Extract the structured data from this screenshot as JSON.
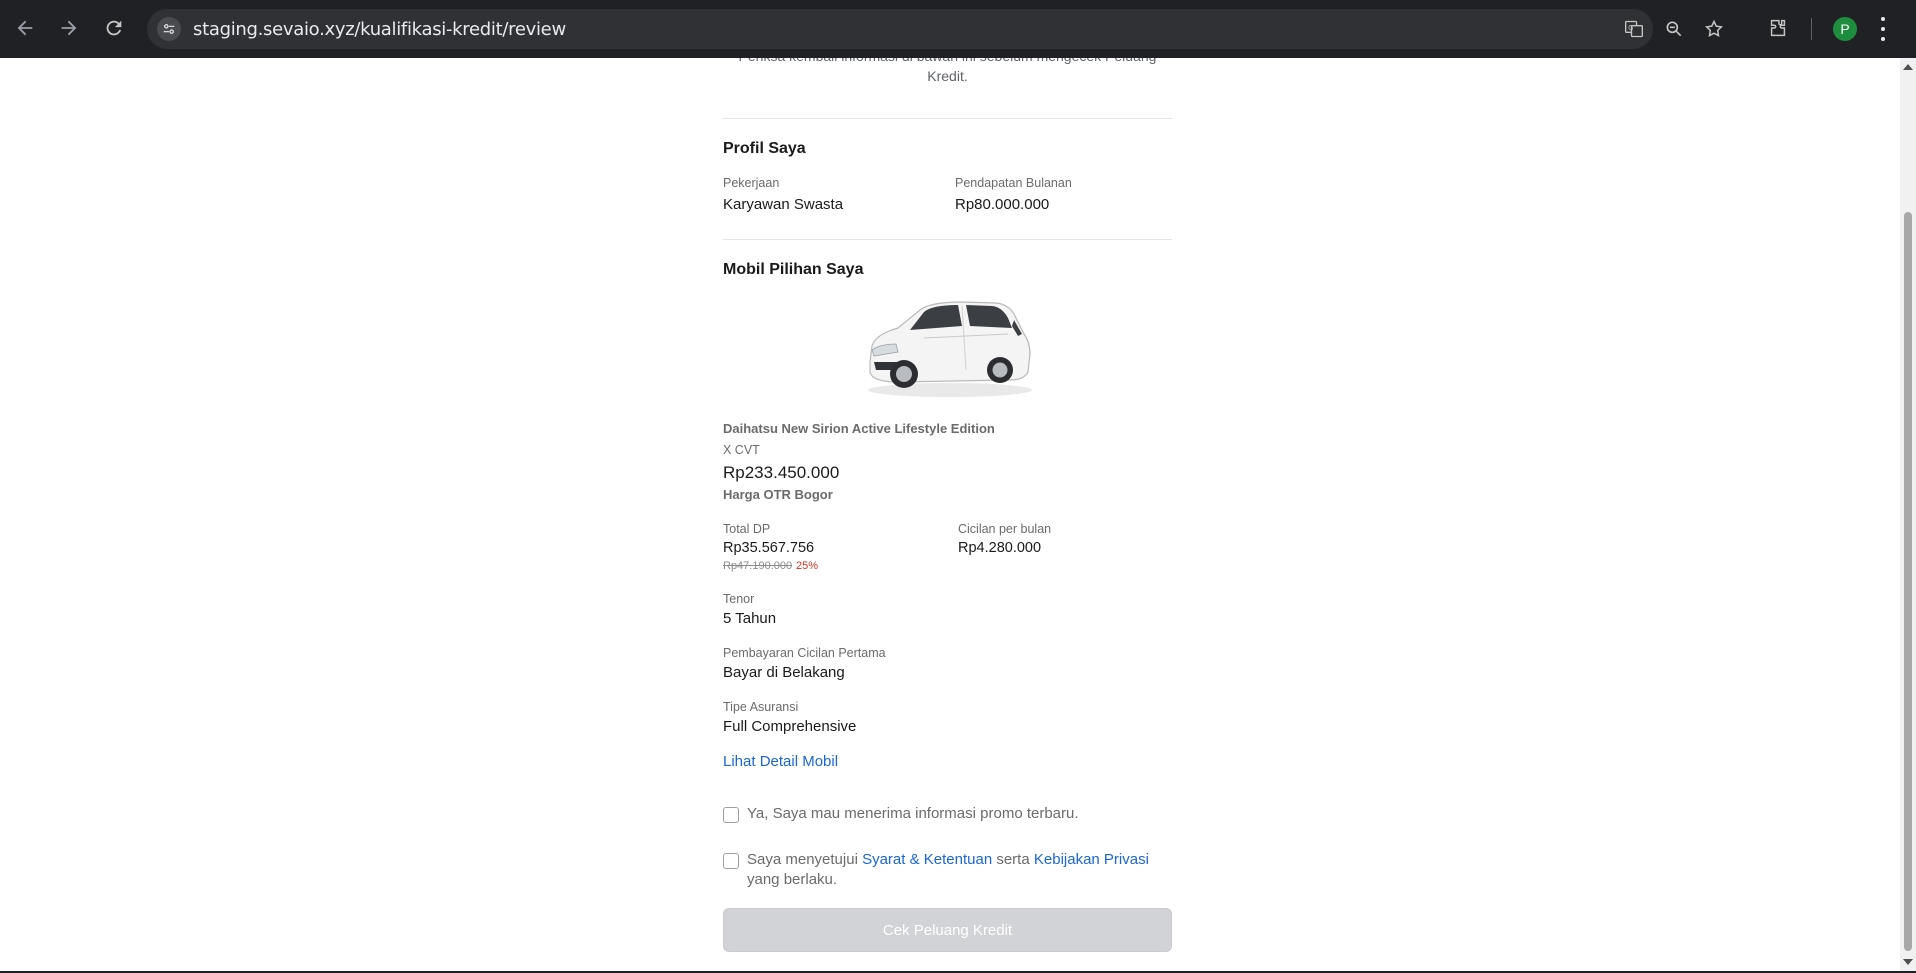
{
  "browser": {
    "url": "staging.sevaio.xyz/kualifikasi-kredit/review",
    "avatar_initial": "P",
    "icons": [
      "back-arrow-icon",
      "forward-arrow-icon",
      "reload-icon",
      "site-settings-icon",
      "translate-icon",
      "zoom-icon",
      "bookmark-star-icon",
      "extensions-icon",
      "more-menu-icon"
    ]
  },
  "page": {
    "intro_text": "Periksa kembali informasi di bawah ini sebelum mengecek Peluang Kredit.",
    "profile": {
      "title": "Profil Saya",
      "occupation_label": "Pekerjaan",
      "occupation_value": "Karyawan Swasta",
      "income_label": "Pendapatan Bulanan",
      "income_value": "Rp80.000.000"
    },
    "car": {
      "title": "Mobil Pilihan Saya",
      "name": "Daihatsu New Sirion Active Lifestyle Edition",
      "variant": "X CVT",
      "price": "Rp233.450.000",
      "price_note": "Harga OTR Bogor",
      "dp_label": "Total DP",
      "dp_value": "Rp35.567.756",
      "dp_original": "Rp47.190.000",
      "dp_percent": "25%",
      "installment_label": "Cicilan per bulan",
      "installment_value": "Rp4.280.000",
      "tenor_label": "Tenor",
      "tenor_value": "5 Tahun",
      "first_payment_label": "Pembayaran Cicilan Pertama",
      "first_payment_value": "Bayar di Belakang",
      "insurance_label": "Tipe Asuransi",
      "insurance_value": "Full Comprehensive",
      "detail_link": "Lihat Detail Mobil"
    },
    "consent": {
      "promo_text": "Ya, Saya mau menerima informasi promo terbaru.",
      "terms_prefix": "Saya menyetujui",
      "terms_link": "Syarat & Ketentuan",
      "terms_mid": "serta",
      "privacy_link": "Kebijakan Privasi",
      "terms_suffix": "yang berlaku."
    },
    "submit_label": "Cek Peluang Kredit"
  },
  "colors": {
    "chrome_bg": "#202124",
    "link": "#1a66d6",
    "discount": "#d93025",
    "button_disabled": "#d1d3d6"
  }
}
